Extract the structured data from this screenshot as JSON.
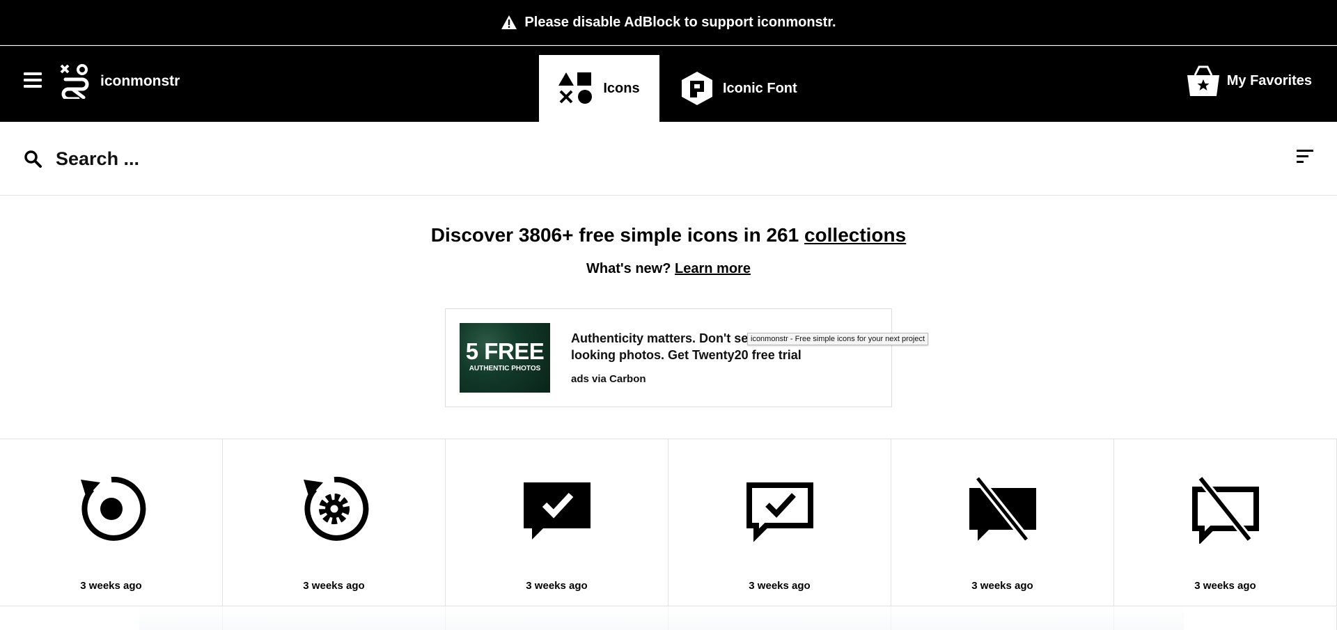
{
  "banner": {
    "text": "Please disable AdBlock to support iconmonstr.",
    "icon": "warning-icon"
  },
  "nav": {
    "brand": "iconmonstr",
    "tabs": [
      {
        "label": "Icons",
        "icon": "shapes-icon",
        "active": true
      },
      {
        "label": "Iconic Font",
        "icon": "font-hexagon-icon",
        "active": false
      }
    ],
    "favorites": "My Favorites"
  },
  "search": {
    "placeholder": "Search ..."
  },
  "hero": {
    "title_prefix": "Discover 3806+ free simple icons in 261 ",
    "title_link": "collections",
    "sub_prefix": "What's new? ",
    "sub_link": "Learn more"
  },
  "ad": {
    "image_big": "5 FREE",
    "image_small": "AUTHENTIC PHOTOS",
    "text": "Authenticity matters. Don't settle for fake-looking photos. Get Twenty20 free trial",
    "via": "ads via Carbon",
    "tooltip": "iconmonstr - Free simple icons for your next project"
  },
  "icons": [
    {
      "name": "refresh-record-icon",
      "time": "3 weeks ago"
    },
    {
      "name": "refresh-gear-icon",
      "time": "3 weeks ago"
    },
    {
      "name": "chat-check-filled-icon",
      "time": "3 weeks ago"
    },
    {
      "name": "chat-check-outline-icon",
      "time": "3 weeks ago"
    },
    {
      "name": "chat-off-filled-icon",
      "time": "3 weeks ago"
    },
    {
      "name": "chat-off-outline-icon",
      "time": "3 weeks ago"
    }
  ],
  "colors": {
    "nav_bg": "#000000",
    "text": "#000000",
    "border": "#e2e2e2"
  }
}
